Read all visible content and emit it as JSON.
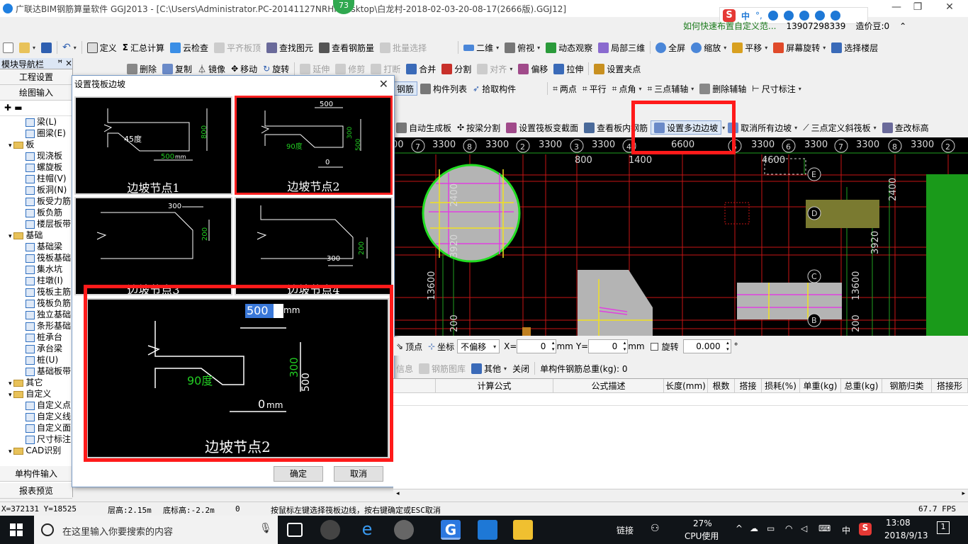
{
  "titlebar": {
    "title": "广联达BIM钢筋算量软件 GGJ2013 - [C:\\Users\\Administrator.PC-20141127NRHI\\Desktop\\白龙村-2018-02-03-20-08-17(2666版).GGJ12]",
    "badge": "73",
    "minimize": "—",
    "restore": "❐",
    "close": "✕"
  },
  "ime": {
    "label": "中",
    "punct": "°,"
  },
  "inforow": {
    "hint": "如何快速布置自定义范...",
    "phone": "13907298339",
    "points_label": "造价豆:0"
  },
  "toolbar1": {
    "define": "定义",
    "sum": "汇总计算",
    "cloud": "云检查",
    "level_slab": "平齐板顶",
    "find": "查找图元",
    "view_rebar": "查看钢筋量",
    "batch": "批量选择",
    "twod": "二维",
    "topview": "俯视",
    "dynamic": "动态观察",
    "local3d": "局部三维",
    "fullscreen": "全屏",
    "zoom": "缩放",
    "pan": "平移",
    "rotate_screen": "屏幕旋转",
    "select_floor": "选择楼层"
  },
  "toolbar2": {
    "delete": "删除",
    "copy": "复制",
    "mirror": "镜像",
    "move": "移动",
    "rotate": "旋转",
    "extend": "延伸",
    "trim": "修剪",
    "break": "打断",
    "merge": "合并",
    "split": "分割",
    "align": "对齐",
    "offset": "偏移",
    "stretch": "拉伸",
    "set_grip": "设置夹点"
  },
  "toolbar3": {
    "rebar": "钢筋",
    "component_list": "构件列表",
    "pick": "拾取构件",
    "two_points": "两点",
    "parallel": "平行",
    "point_angle": "点角",
    "three_point_axis": "三点辅轴",
    "delete_axis": "删除辅轴",
    "dimension": "尺寸标注"
  },
  "toolbar4": {
    "auto_gen": "自动生成板",
    "beam_split": "按梁分割",
    "set_section": "设置筏板变截面",
    "view_inner": "查看板内钢筋",
    "set_multi_slope": "设置多边边坡",
    "cancel_slope": "取消所有边坡",
    "three_point_slope": "三点定义斜筏板",
    "change_elev": "查改标高"
  },
  "axis_top": [
    "00",
    "7",
    "3300",
    "8",
    "3300",
    "2",
    "3300",
    "3",
    "3300",
    "4",
    "6600",
    "5",
    "3300",
    "6",
    "3300",
    "7",
    "3300",
    "8",
    "3300",
    "2"
  ],
  "canvas_dims": {
    "d800": "800",
    "d1400": "1400",
    "d4600": "4600",
    "d2400a": "2400",
    "d3920a": "3920",
    "d2400b": "2400",
    "d13600a": "13600",
    "d13600b": "13600",
    "d3920b": "3920",
    "d200a": "200",
    "d200b": "200",
    "axE": "E",
    "axD": "D",
    "axC": "C",
    "axB": "B"
  },
  "leftnav": {
    "title": "模块导航栏",
    "pin": "ꟸ ×",
    "project_settings": "工程设置",
    "drawing_input": "绘图输入",
    "tree": [
      {
        "label": "梁(L)",
        "indent": 3,
        "type": "item"
      },
      {
        "label": "圈梁(E)",
        "indent": 3,
        "type": "item"
      },
      {
        "label": "板",
        "indent": 1,
        "type": "folder"
      },
      {
        "label": "现浇板",
        "indent": 3,
        "type": "item"
      },
      {
        "label": "螺旋板",
        "indent": 3,
        "type": "item"
      },
      {
        "label": "柱帽(V)",
        "indent": 3,
        "type": "item"
      },
      {
        "label": "板洞(N)",
        "indent": 3,
        "type": "item"
      },
      {
        "label": "板受力筋",
        "indent": 3,
        "type": "item"
      },
      {
        "label": "板负筋",
        "indent": 3,
        "type": "item"
      },
      {
        "label": "楼层板带",
        "indent": 3,
        "type": "item"
      },
      {
        "label": "基础",
        "indent": 1,
        "type": "folder"
      },
      {
        "label": "基础梁",
        "indent": 3,
        "type": "item"
      },
      {
        "label": "筏板基础",
        "indent": 3,
        "type": "item"
      },
      {
        "label": "集水坑",
        "indent": 3,
        "type": "item"
      },
      {
        "label": "柱墩(I)",
        "indent": 3,
        "type": "item"
      },
      {
        "label": "筏板主筋",
        "indent": 3,
        "type": "item"
      },
      {
        "label": "筏板负筋",
        "indent": 3,
        "type": "item"
      },
      {
        "label": "独立基础",
        "indent": 3,
        "type": "item"
      },
      {
        "label": "条形基础",
        "indent": 3,
        "type": "item"
      },
      {
        "label": "桩承台",
        "indent": 3,
        "type": "item"
      },
      {
        "label": "承台梁",
        "indent": 3,
        "type": "item"
      },
      {
        "label": "桩(U)",
        "indent": 3,
        "type": "item"
      },
      {
        "label": "基础板带",
        "indent": 3,
        "type": "item"
      },
      {
        "label": "其它",
        "indent": 1,
        "type": "folder"
      },
      {
        "label": "自定义",
        "indent": 1,
        "type": "folder"
      },
      {
        "label": "自定义点",
        "indent": 3,
        "type": "item"
      },
      {
        "label": "自定义线",
        "indent": 3,
        "type": "item"
      },
      {
        "label": "自定义面",
        "indent": 3,
        "type": "item"
      },
      {
        "label": "尺寸标注",
        "indent": 3,
        "type": "item"
      },
      {
        "label": "CAD识别",
        "indent": 1,
        "type": "folder"
      }
    ],
    "single_component": "单构件输入",
    "report": "报表预览"
  },
  "dialog": {
    "title": "设置筏板边坡",
    "close": "✕",
    "nodes": [
      {
        "label": "边坡节点1",
        "d_top": "",
        "d_side": "800",
        "d_bottom": "500",
        "angle": "45度"
      },
      {
        "label": "边坡节点2",
        "d_top": "500",
        "d_side": "300",
        "d_side2": "500",
        "d_bottom": "0",
        "angle": "90度"
      },
      {
        "label": "边坡节点3",
        "d_top": "300",
        "d_side": "200"
      },
      {
        "label": "边坡节点4",
        "d_side": "200",
        "d_bottom": "300"
      }
    ],
    "unit": "mm",
    "preview": {
      "label": "边坡节点2",
      "top_value": "500",
      "side_value": "300",
      "side_value2": "500",
      "bottom_value": "0",
      "angle": "90度"
    },
    "ok": "确定",
    "cancel": "取消"
  },
  "proprow": {
    "vertex": "顶点",
    "coord": "坐标",
    "offset_mode": "不偏移",
    "x_label": "X=",
    "x_value": "0",
    "y_label": "Y=",
    "y_value": "0",
    "mm": "mm",
    "rotate": "旋转",
    "rotate_value": "0.000",
    "deg": "°"
  },
  "rebarbar": {
    "info": "信息",
    "library": "钢筋图库",
    "other": "其他",
    "close": "关闭",
    "total": "单构件钢筋总重(kg): 0"
  },
  "table_headers": [
    "计算公式",
    "公式描述",
    "长度(mm)",
    "根数",
    "搭接",
    "损耗(%)",
    "单重(kg)",
    "总重(kg)",
    "钢筋归类",
    "搭接形"
  ],
  "statusbar": {
    "coords": "X=372131  Y=18525",
    "floor_height": "层高:2.15m",
    "bottom_elev": "底标高:-2.2m",
    "zero": "0",
    "prompt": "按鼠标左键选择筏板边线，按右键确定或ESC取消",
    "fps": "67.7 FPS"
  },
  "taskbar": {
    "search": "在这里输入你要搜索的内容",
    "link": "链接",
    "cpu_pct": "27%",
    "cpu_label": "CPU使用",
    "lang": "中",
    "time": "13:08",
    "date": "2018/9/13",
    "notif": "1"
  },
  "colors": {
    "highlight_red": "#ff1a1a",
    "canvas_bg": "#000000",
    "grid_red": "#c81414",
    "grid_green": "#00c000",
    "dim_green": "#22cc22"
  }
}
